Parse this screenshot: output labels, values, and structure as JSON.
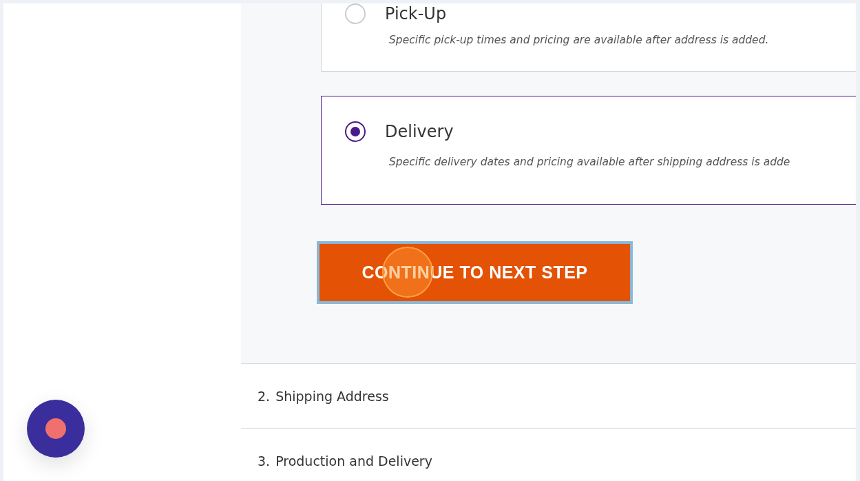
{
  "delivery_options": [
    {
      "label": "Pick-Up",
      "description": "Specific pick-up times and pricing are available after address is added.",
      "selected": false
    },
    {
      "label": "Delivery",
      "description": "Specific delivery dates and pricing available after shipping address is adde",
      "selected": true
    }
  ],
  "continue_button": {
    "label": "CONTINUE TO NEXT STEP"
  },
  "steps": [
    {
      "number": "2.",
      "title": "Shipping Address"
    },
    {
      "number": "3.",
      "title": "Production and Delivery"
    }
  ]
}
